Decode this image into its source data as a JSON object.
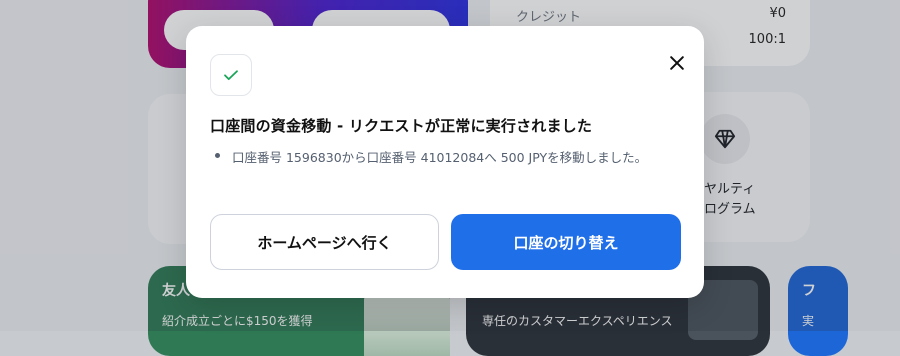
{
  "background": {
    "credit_label": "クレジット",
    "credit_value": "¥0",
    "leverage_value": "100:1",
    "loyalty_label_line1": "ヤルティ",
    "loyalty_label_line2": "ログラム",
    "referral_title": "友人",
    "referral_subtitle": "紹介成立ごとに$150を獲得",
    "care_line1": "専任のカスタマーエクスペリエンス",
    "blue_title": "フ",
    "blue_text": "実"
  },
  "modal": {
    "title": "口座間の資金移動 - リクエストが正常に実行されました",
    "message": "口座番号 1596830から口座番号 41012084へ 500 JPYを移動しました。",
    "home_button": "ホームページへ行く",
    "switch_button": "口座の切り替え",
    "icons": {
      "success": "check-icon",
      "close": "close-icon"
    },
    "colors": {
      "primary": "#1f6fe9",
      "success": "#1aa55a"
    }
  }
}
